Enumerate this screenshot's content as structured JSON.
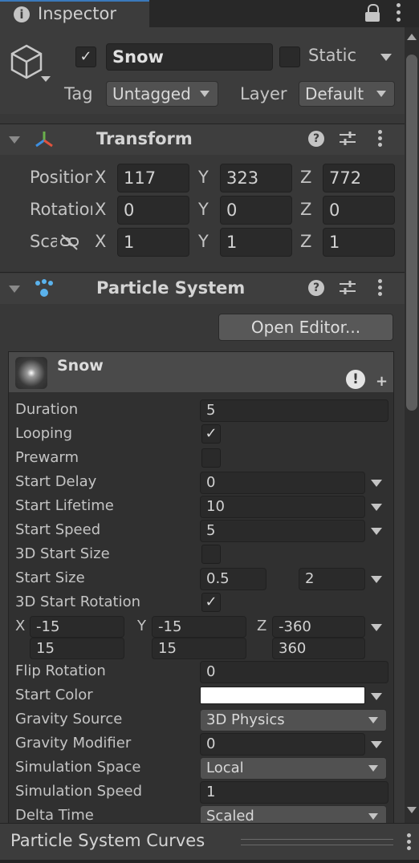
{
  "tab": {
    "title": "Inspector"
  },
  "gameobject": {
    "active": true,
    "name": "Snow",
    "static_label": "Static",
    "tag_label": "Tag",
    "tag_value": "Untagged",
    "layer_label": "Layer",
    "layer_value": "Default"
  },
  "transform": {
    "title": "Transform",
    "position": {
      "label": "Position",
      "x": "117",
      "y": "323",
      "z": "772"
    },
    "rotation": {
      "label": "Rotation",
      "x": "0",
      "y": "0",
      "z": "0"
    },
    "scale": {
      "label": "Scale",
      "x": "1",
      "y": "1",
      "z": "1"
    },
    "axis": {
      "x": "X",
      "y": "Y",
      "z": "Z"
    }
  },
  "particle_system": {
    "title": "Particle System",
    "open_editor": "Open Editor...",
    "module_title": "Snow",
    "rows": {
      "duration": {
        "label": "Duration",
        "value": "5"
      },
      "looping": {
        "label": "Looping",
        "checked": true
      },
      "prewarm": {
        "label": "Prewarm",
        "checked": false
      },
      "start_delay": {
        "label": "Start Delay",
        "value": "0"
      },
      "start_lifetime": {
        "label": "Start Lifetime",
        "value": "10"
      },
      "start_speed": {
        "label": "Start Speed",
        "value": "5"
      },
      "start_size_3d": {
        "label": "3D Start Size",
        "checked": false
      },
      "start_size": {
        "label": "Start Size",
        "min": "0.5",
        "max": "2"
      },
      "start_rotation_3d": {
        "label": "3D Start Rotation",
        "checked": true
      },
      "rotation_min": {
        "x": "-15",
        "y": "-15",
        "z": "-360"
      },
      "rotation_max": {
        "x": "15",
        "y": "15",
        "z": "360"
      },
      "flip_rotation": {
        "label": "Flip Rotation",
        "value": "0"
      },
      "start_color": {
        "label": "Start Color",
        "color": "#ffffff"
      },
      "gravity_source": {
        "label": "Gravity Source",
        "value": "3D Physics"
      },
      "gravity_modifier": {
        "label": "Gravity Modifier",
        "value": "0"
      },
      "simulation_space": {
        "label": "Simulation Space",
        "value": "Local"
      },
      "simulation_speed": {
        "label": "Simulation Speed",
        "value": "1"
      },
      "delta_time": {
        "label": "Delta Time",
        "value": "Scaled"
      }
    }
  },
  "curves": {
    "title": "Particle System Curves"
  }
}
